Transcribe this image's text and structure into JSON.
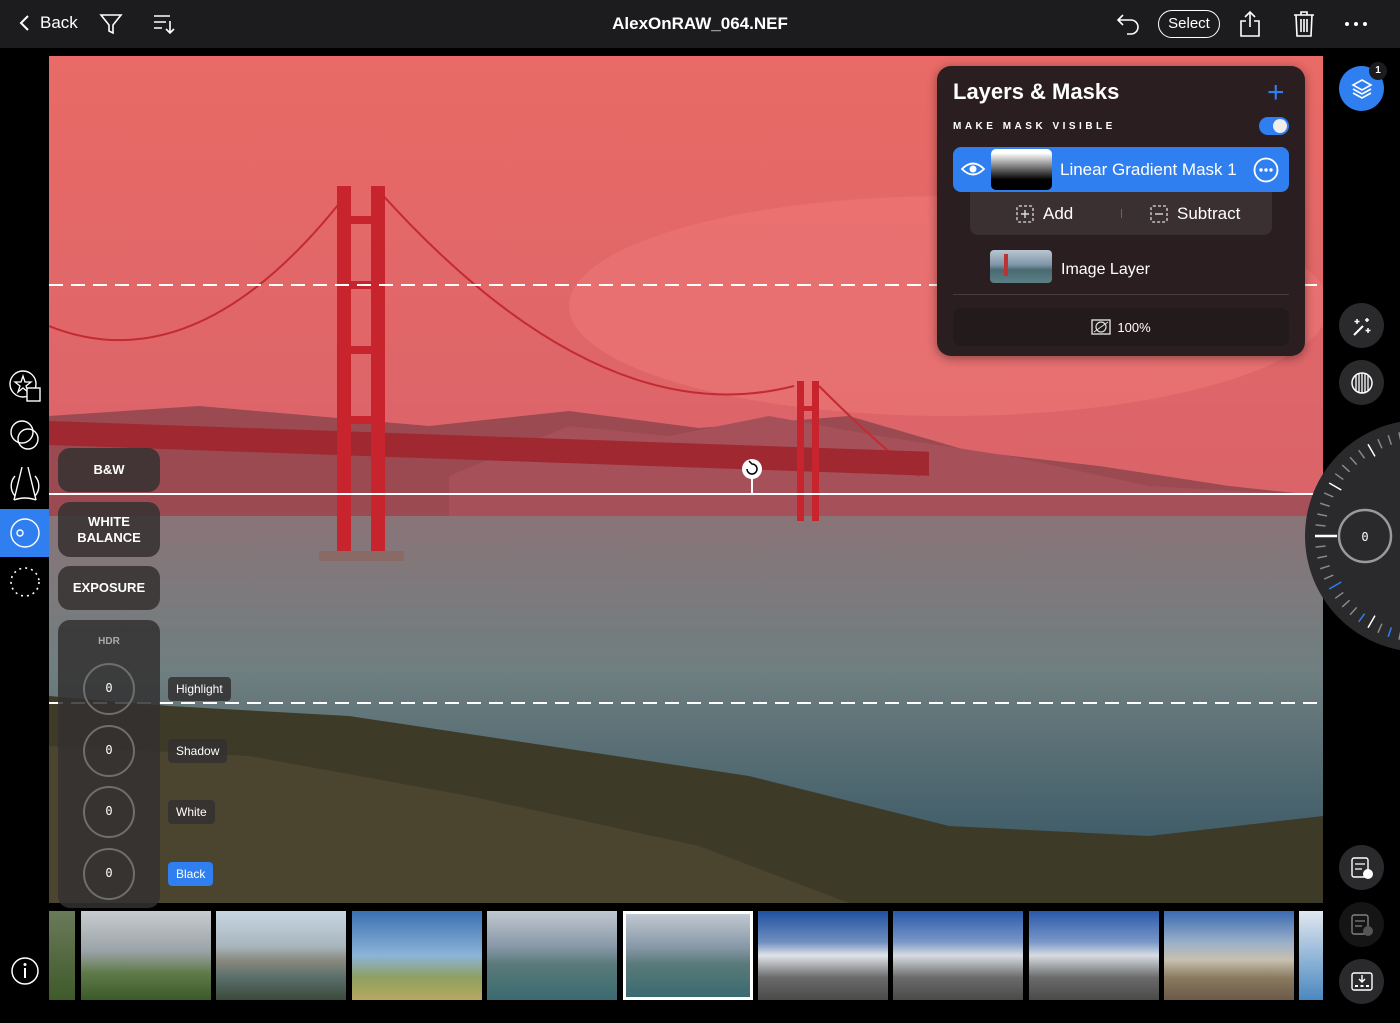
{
  "topbar": {
    "back_label": "Back",
    "title": "AlexOnRAW_064.NEF",
    "select_label": "Select"
  },
  "tools": {
    "bw": "B&W",
    "white_balance_line1": "WHITE",
    "white_balance_line2": "BALANCE",
    "exposure": "EXPOSURE"
  },
  "hdr": {
    "label": "HDR",
    "knobs": [
      {
        "value": "0",
        "tag": "Highlight"
      },
      {
        "value": "0",
        "tag": "Shadow"
      },
      {
        "value": "0",
        "tag": "White"
      },
      {
        "value": "0",
        "tag": "Black",
        "active": true
      }
    ]
  },
  "panel": {
    "title": "Layers & Masks",
    "make_mask_visible": "MAKE MASK VISIBLE",
    "mask_visible": true,
    "mask_name": "Linear Gradient Mask 1",
    "add": "Add",
    "subtract": "Subtract",
    "image_layer": "Image Layer",
    "opacity": "100%"
  },
  "layers_badge": "1",
  "dial": {
    "value": "0"
  },
  "colors": {
    "accent": "#2f7ff0",
    "mask_overlay": "#e85c5c",
    "panel_bg": "#2b1e20"
  },
  "icons": [
    "back-chevron",
    "filter",
    "sort",
    "undo",
    "share",
    "trash",
    "more",
    "layers",
    "magic-wand",
    "stripes-circle",
    "presets",
    "masks",
    "perspective",
    "tone-curve",
    "vignette",
    "info",
    "copy-adjustments",
    "paste-adjustments",
    "export"
  ]
}
